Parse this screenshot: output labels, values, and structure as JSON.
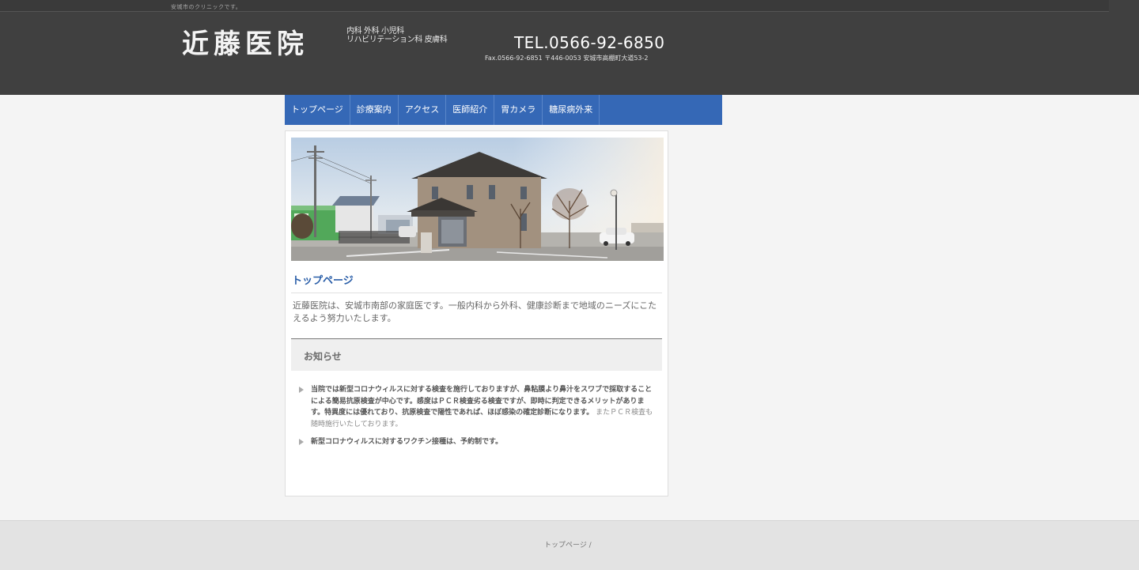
{
  "header": {
    "tagline": "安城市のクリニックです。",
    "logo_text": "近藤医院",
    "departments_line1": "内科 外科 小児科",
    "departments_line2": "リハビリテーション科 皮膚科",
    "tel": "TEL.0566-92-6850",
    "address": "Fax.0566-92-6851 〒446-0053 安城市高棚町大道53-2"
  },
  "nav": {
    "items": [
      {
        "label": "トップページ"
      },
      {
        "label": "診療案内"
      },
      {
        "label": "アクセス"
      },
      {
        "label": "医師紹介"
      },
      {
        "label": "胃カメラ"
      },
      {
        "label": "糖尿病外来"
      }
    ]
  },
  "main": {
    "page_title": "トップページ",
    "intro": "近藤医院は、安城市南部の家庭医です。一般内科から外科、健康診断まで地域のニーズにこたえるよう努力いたします。",
    "news_title": "お知らせ",
    "news_items": [
      {
        "bold": "当院では新型コロナウィルスに対する検査を施行しておりますが、鼻粘膜より鼻汁をスワブで採取することによる簡易抗原検査が中心です。感度はＰＣＲ検査劣る検査ですが、即時に判定できるメリットがあります。特異度には優れており、抗原検査で陽性であれば、ほぼ感染の確定診断になります。",
        "light": "またＰＣＲ検査も随時施行いたしております。"
      },
      {
        "bold": "新型コロナウィルスに対するワクチン接種は、予約制です。",
        "light": ""
      }
    ]
  },
  "footer": {
    "breadcrumb": "トップページ /"
  },
  "colors": {
    "header_bg": "#404040",
    "nav_bg": "#3568b6",
    "title_blue": "#2a5ea8"
  }
}
